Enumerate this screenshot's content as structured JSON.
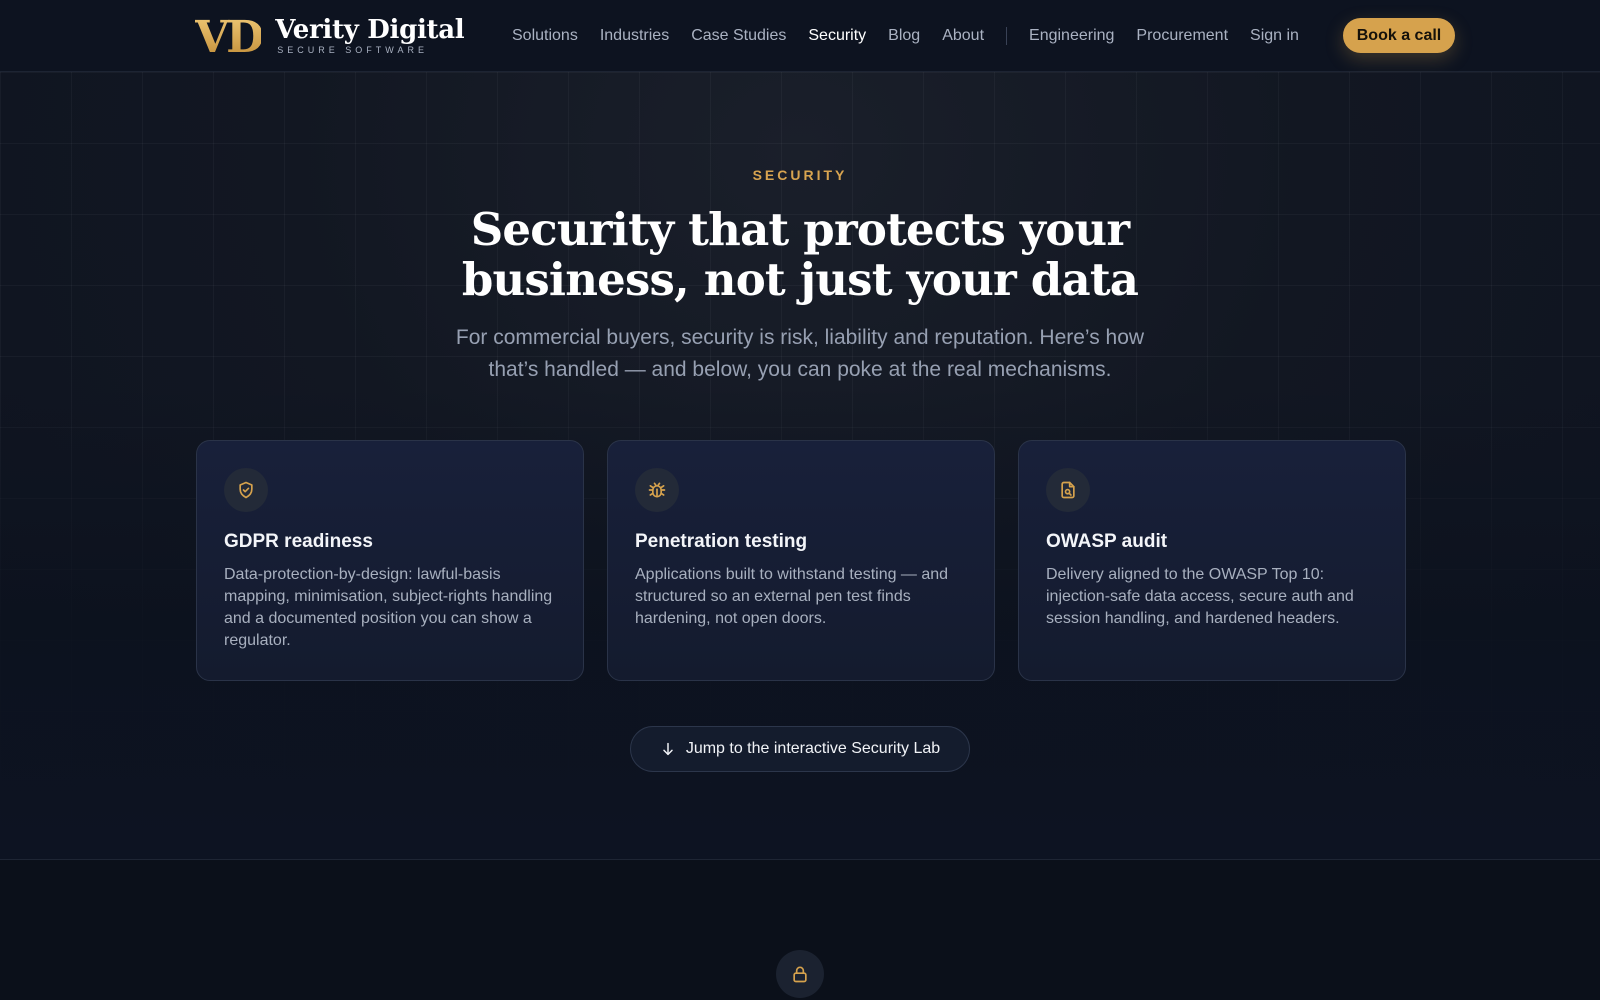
{
  "brand": {
    "mark": "VD",
    "name": "Verity Digital",
    "tagline": "SECURE SOFTWARE"
  },
  "nav": {
    "primary": [
      "Solutions",
      "Industries",
      "Case Studies",
      "Security",
      "Blog",
      "About"
    ],
    "active": "Security",
    "secondary": [
      "Engineering",
      "Procurement",
      "Sign in"
    ],
    "cta": "Book a call"
  },
  "hero": {
    "eyebrow": "SECURITY",
    "title": "Security that protects your business, not just your data",
    "subtitle": "For commercial buyers, security is risk, liability and reputation. Here’s how that’s handled — and below, you can poke at the real mechanisms."
  },
  "cards": [
    {
      "icon": "shield-check-icon",
      "title": "GDPR readiness",
      "desc": "Data-protection-by-design: lawful-basis mapping, minimisation, subject-rights handling and a documented position you can show a regulator."
    },
    {
      "icon": "bug-icon",
      "title": "Penetration testing",
      "desc": "Applications built to withstand testing — and structured so an external pen test finds hardening, not open doors."
    },
    {
      "icon": "file-search-icon",
      "title": "OWASP audit",
      "desc": "Delivery aligned to the OWASP Top 10: injection-safe data access, secure auth and session handling, and hardened headers."
    }
  ],
  "jump": {
    "label": "Jump to the interactive Security Lab",
    "icon": "arrow-down-icon"
  },
  "next_section": {
    "icon": "lock-icon"
  },
  "colors": {
    "accent": "#d6a24d",
    "background": "#0b101a"
  }
}
